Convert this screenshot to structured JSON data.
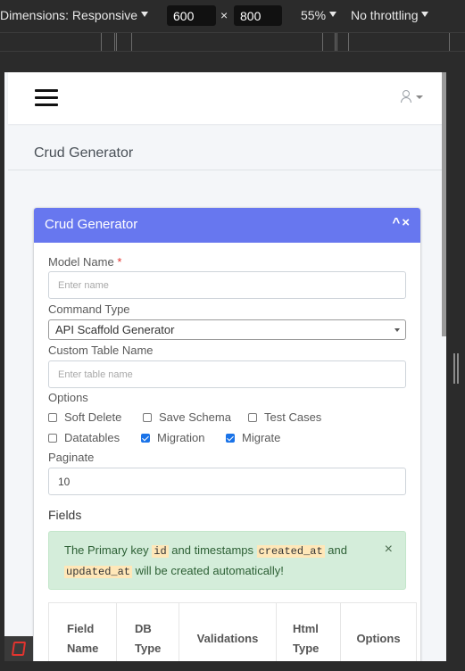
{
  "devtools": {
    "dimensions_label": "Dimensions: Responsive",
    "width": "600",
    "times": "×",
    "height": "800",
    "zoom": "55%",
    "throttling": "No throttling"
  },
  "navbar": {
    "menu_icon": "hamburger-icon",
    "user_icon": "user-icon"
  },
  "page": {
    "title": "Crud Generator"
  },
  "card": {
    "title": "Crud Generator",
    "collapse_icon": "^",
    "close_icon": "×"
  },
  "form": {
    "model_name_label": "Model Name",
    "required_mark": "*",
    "model_name_placeholder": "Enter name",
    "command_type_label": "Command Type",
    "command_type_value": "API Scaffold Generator",
    "custom_table_label": "Custom Table Name",
    "custom_table_placeholder": "Enter table name",
    "options_label": "Options",
    "options": [
      {
        "label": "Soft Delete",
        "checked": false
      },
      {
        "label": "Save Schema",
        "checked": false
      },
      {
        "label": "Test Cases",
        "checked": false
      },
      {
        "label": "Datatables",
        "checked": false
      },
      {
        "label": "Migration",
        "checked": true
      },
      {
        "label": "Migrate",
        "checked": true
      }
    ],
    "paginate_label": "Paginate",
    "paginate_value": "10"
  },
  "fields": {
    "heading": "Fields",
    "alert": {
      "text_1": "The Primary key ",
      "code_1": "id",
      "text_2": " and timestamps ",
      "code_2": "created_at",
      "text_3": " and ",
      "code_3": "updated_at",
      "text_4": " will be created automatically!",
      "close": "×"
    },
    "columns": [
      "Field Name",
      "DB Type",
      "Validations",
      "Html Type",
      "Options"
    ]
  },
  "colors": {
    "card_header": "#6777ef",
    "alert_bg": "#d4edda",
    "checkbox_checked": "#1a73e8"
  }
}
